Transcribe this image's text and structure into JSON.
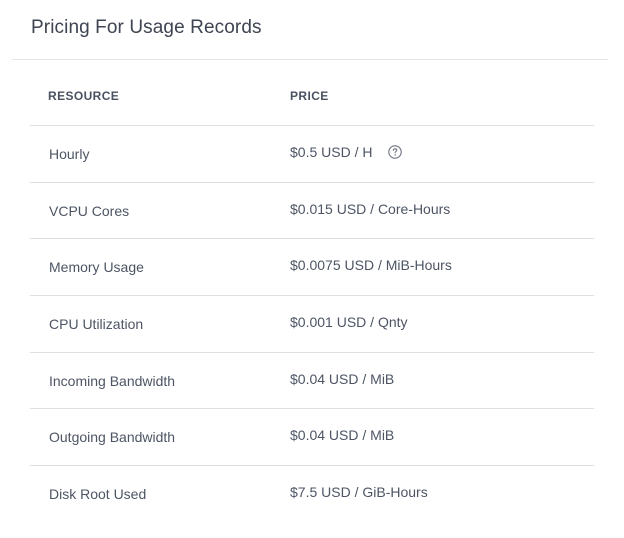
{
  "panel": {
    "title": "Pricing For Usage Records"
  },
  "table": {
    "columns": {
      "resource": "RESOURCE",
      "price": "PRICE"
    },
    "rows": [
      {
        "resource": "Hourly",
        "price": "$0.5 USD / H",
        "icon": "help-circle-icon"
      },
      {
        "resource": "VCPU Cores",
        "price": "$0.015 USD / Core-Hours"
      },
      {
        "resource": "Memory Usage",
        "price": "$0.0075 USD / MiB-Hours"
      },
      {
        "resource": "CPU Utilization",
        "price": "$0.001 USD / Qnty"
      },
      {
        "resource": "Incoming Bandwidth",
        "price": "$0.04 USD / MiB"
      },
      {
        "resource": "Outgoing Bandwidth",
        "price": "$0.04 USD / MiB"
      },
      {
        "resource": "Disk Root Used",
        "price": "$7.5 USD / GiB-Hours"
      }
    ]
  },
  "colors": {
    "title": "#3e4451",
    "text": "#4d5564",
    "divider": "#dcdfe3",
    "icon": "#6b7280"
  }
}
